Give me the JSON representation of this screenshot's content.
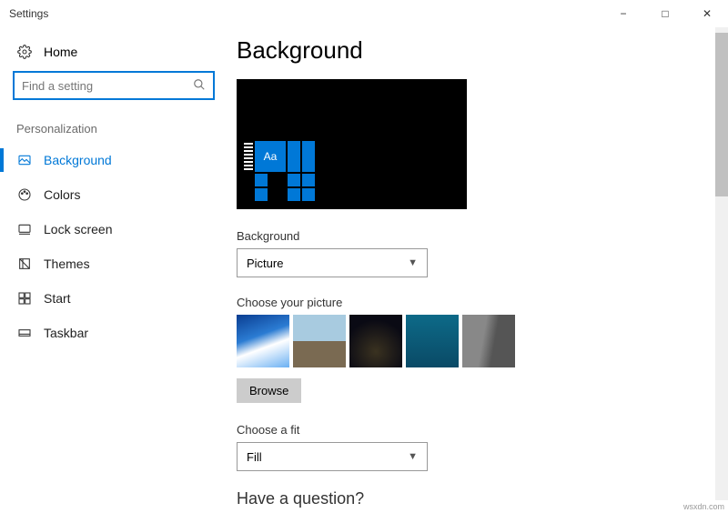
{
  "titlebar": {
    "title": "Settings"
  },
  "sidebar": {
    "home_label": "Home",
    "search_placeholder": "Find a setting",
    "category": "Personalization",
    "items": [
      {
        "label": "Background"
      },
      {
        "label": "Colors"
      },
      {
        "label": "Lock screen"
      },
      {
        "label": "Themes"
      },
      {
        "label": "Start"
      },
      {
        "label": "Taskbar"
      }
    ]
  },
  "main": {
    "title": "Background",
    "preview_tile_text": "Aa",
    "background_label": "Background",
    "background_value": "Picture",
    "choose_picture_label": "Choose your picture",
    "browse_label": "Browse",
    "fit_label": "Choose a fit",
    "fit_value": "Fill",
    "question_heading": "Have a question?"
  },
  "watermark": "wsxdn.com"
}
